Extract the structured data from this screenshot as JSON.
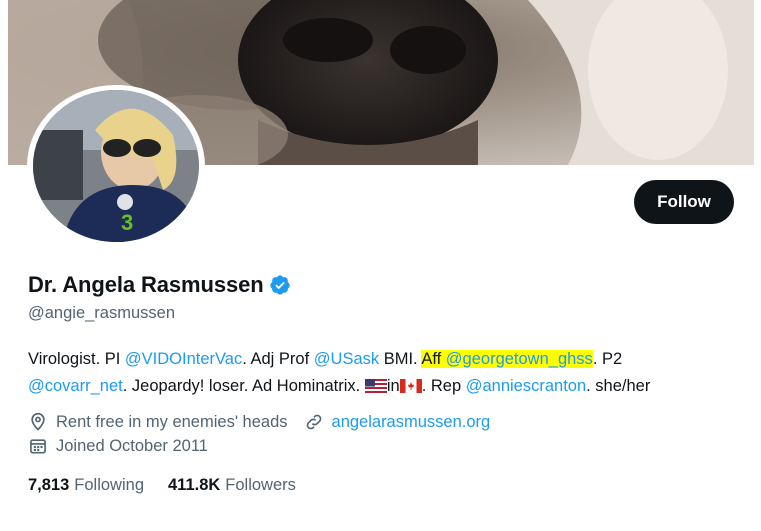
{
  "profile": {
    "display_name": "Dr. Angela Rasmussen",
    "handle": "@angie_rasmussen",
    "follow_label": "Follow"
  },
  "bio": {
    "t1": "Virologist. PI ",
    "link1": "@VIDOInterVac",
    "t2": ". Adj Prof ",
    "link2": "@USask",
    "t3": " BMI. ",
    "aff_text": "Aff ",
    "link3": "@georgetown_ghss",
    "t4": ". P2 ",
    "link4": "@covarr_net",
    "t5": ". Jeopardy! loser. Ad Hominatrix. ",
    "t6": "in",
    "t7": ". Rep ",
    "link5": "@anniescranton",
    "t8": ". she/her"
  },
  "meta": {
    "location": "Rent free in my enemies' heads",
    "website": "angelarasmussen.org",
    "joined": "Joined October 2011"
  },
  "stats": {
    "following_count": "7,813",
    "following_label": "Following",
    "followers_count": "411.8K",
    "followers_label": "Followers"
  },
  "colors": {
    "link": "#1d9bf0",
    "highlight": "#ffff00",
    "button_bg": "#0f1419",
    "secondary_text": "#536471"
  }
}
